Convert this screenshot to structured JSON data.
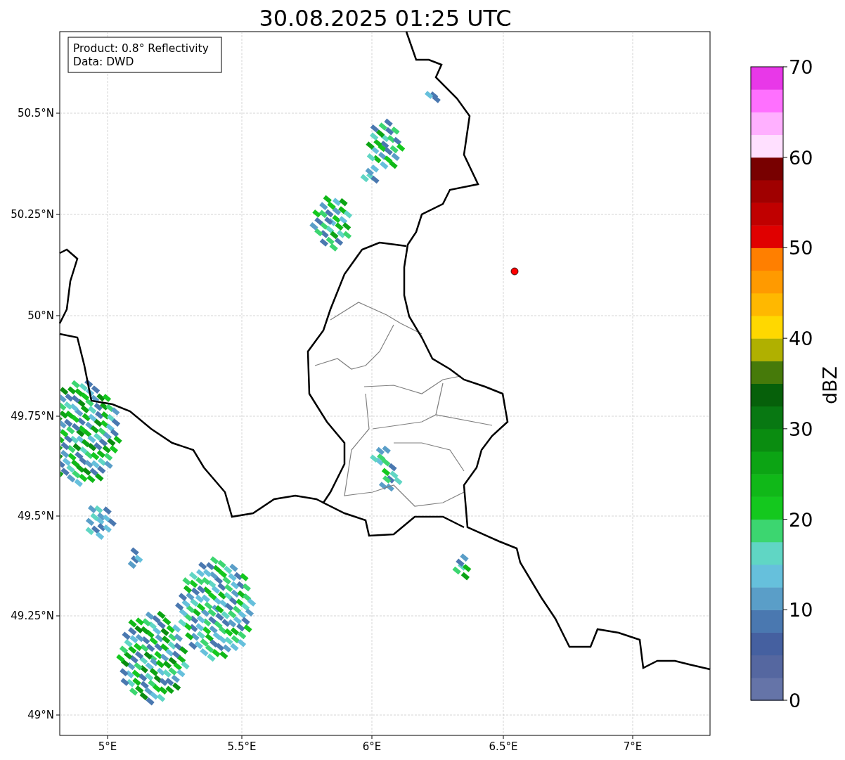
{
  "title": "30.08.2025 01:25 UTC",
  "legend": [
    "Product: 0.8° Reflectivity",
    "Data: DWD"
  ],
  "lat_ticks": [
    "50.5°N",
    "50.25°N",
    "50°N",
    "49.75°N",
    "49.5°N",
    "49.25°N",
    "49°N"
  ],
  "lon_ticks": [
    "5°E",
    "5.5°E",
    "6°E",
    "6.5°E",
    "7°E"
  ],
  "colorbar": {
    "label": "dBZ",
    "ticks": [
      "70",
      "60",
      "50",
      "40",
      "30",
      "20",
      "10",
      "0"
    ],
    "segments": [
      {
        "color": "#6574a8"
      },
      {
        "color": "#5567a0"
      },
      {
        "color": "#4560a0"
      },
      {
        "color": "#4a78b0"
      },
      {
        "color": "#5a9ec8"
      },
      {
        "color": "#66c0dc"
      },
      {
        "color": "#60d6c4"
      },
      {
        "color": "#3cd670"
      },
      {
        "color": "#14c81e"
      },
      {
        "color": "#10b818"
      },
      {
        "color": "#0ca414"
      },
      {
        "color": "#0a8c10"
      },
      {
        "color": "#087812"
      },
      {
        "color": "#06600a"
      },
      {
        "color": "#467a0a"
      },
      {
        "color": "#b0b000"
      },
      {
        "color": "#ffd800"
      },
      {
        "color": "#ffb800"
      },
      {
        "color": "#ff9a00"
      },
      {
        "color": "#ff7f00"
      },
      {
        "color": "#e00000"
      },
      {
        "color": "#c00000"
      },
      {
        "color": "#a00000"
      },
      {
        "color": "#780000"
      },
      {
        "color": "#ffe0ff"
      },
      {
        "color": "#ffb0ff"
      },
      {
        "color": "#ff70ff"
      },
      {
        "color": "#e838e8"
      }
    ]
  }
}
